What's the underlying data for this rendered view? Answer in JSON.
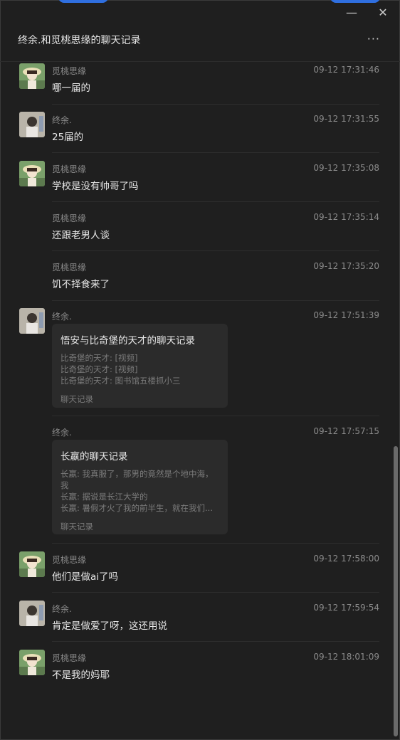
{
  "window": {
    "title": "终余.和觅桃思缘的聊天记录",
    "more_label": "···",
    "minimize_label": "—",
    "close_label": "✕"
  },
  "messages": [
    {
      "sender": "觅桃思缘",
      "time": "09-12 17:31:46",
      "text": "哪一届的",
      "avatar": "peach-avatar"
    },
    {
      "sender": "终余.",
      "time": "09-12 17:31:55",
      "text": "25届的",
      "avatar": "user-avatar"
    },
    {
      "sender": "觅桃思缘",
      "time": "09-12 17:35:08",
      "text": "学校是没有帅哥了吗",
      "avatar": "peach-avatar"
    },
    {
      "sender": "觅桃思缘",
      "time": "09-12 17:35:14",
      "text": "还跟老男人谈"
    },
    {
      "sender": "觅桃思缘",
      "time": "09-12 17:35:20",
      "text": "饥不择食来了"
    },
    {
      "sender": "终余.",
      "time": "09-12 17:51:39",
      "avatar": "user-avatar",
      "card": {
        "title": "悟安与比奇堡的天才的聊天记录",
        "lines": [
          "比奇堡的天才: [视频]",
          "比奇堡的天才: [视频]",
          "比奇堡的天才: 图书馆五楼抓小三"
        ],
        "footer": "聊天记录"
      }
    },
    {
      "sender": "终余.",
      "time": "09-12 17:57:15",
      "card": {
        "title": "长嬴的聊天记录",
        "lines": [
          "长嬴: 我真服了，那男的竟然是个地中海，",
          "我",
          "长嬴: 据说是长江大学的",
          "长嬴: 暑假才火了我的前半生，就在我们..."
        ],
        "footer": "聊天记录"
      }
    },
    {
      "sender": "觅桃思缘",
      "time": "09-12 17:58:00",
      "text": "他们是做ai了吗",
      "avatar": "peach-avatar"
    },
    {
      "sender": "终余.",
      "time": "09-12 17:59:54",
      "text": "肯定是做爱了呀，这还用说",
      "avatar": "user-avatar"
    },
    {
      "sender": "觅桃思缘",
      "time": "09-12 18:01:09",
      "text": "不是我的妈耶",
      "avatar": "peach-avatar"
    }
  ]
}
